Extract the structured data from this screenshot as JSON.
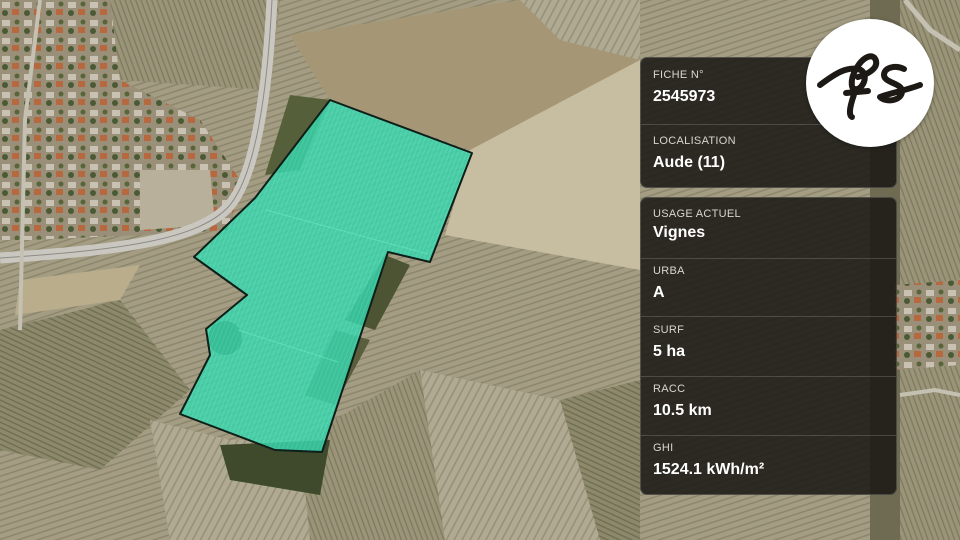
{
  "map": {
    "parcel_color": "#2ed8ad",
    "parcel_outline": "#0d1f18"
  },
  "info_top": {
    "fiche_label": "FICHE N°",
    "fiche_value": "2545973",
    "loc_label": "LOCALISATION",
    "loc_value": "Aude (11)"
  },
  "info_bottom": {
    "usage_label": "USAGE ACTUEL",
    "usage_value": "Vignes",
    "urba_label": "URBA",
    "urba_value": "A",
    "surf_label": "SURF",
    "surf_value": "5 ha",
    "racc_label": "RACC",
    "racc_value": "10.5 km",
    "ghi_label": "GHI",
    "ghi_value": "1524.1 kWh/m²"
  },
  "logo": {
    "icon": "fs-monogram-logo"
  }
}
